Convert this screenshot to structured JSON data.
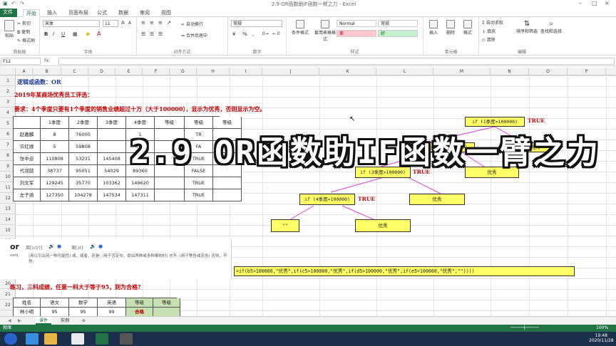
{
  "window": {
    "title": "2.9 OR函数助IF函数一臂之力 - Excel"
  },
  "tabs": [
    "文件",
    "开始",
    "插入",
    "页面布局",
    "公式",
    "数据",
    "审阅",
    "视图"
  ],
  "ribbon": {
    "clipboard": {
      "label": "剪贴板",
      "paste": "粘贴",
      "cut": "剪切",
      "copy": "复制",
      "format_painter": "格式刷"
    },
    "font": {
      "label": "字体",
      "name": "宋体",
      "size": "11",
      "bold": "B",
      "italic": "I",
      "underline": "U"
    },
    "alignment": {
      "label": "对齐方式",
      "wrap": "自动换行",
      "merge": "合并后居中"
    },
    "number": {
      "label": "数字",
      "format": "常规",
      "percent": "%",
      "comma": ","
    },
    "styles": {
      "label": "样式",
      "conditional": "条件格式",
      "table": "套用表格格式",
      "cells": [
        {
          "text": "Normal",
          "bg": "#ffffff"
        },
        {
          "text": "常规",
          "bg": "#ffffff"
        },
        {
          "text": "差",
          "bg": "#ffc7ce"
        },
        {
          "text": "好",
          "bg": "#c6efce"
        }
      ]
    },
    "cells": {
      "label": "单元格",
      "insert": "插入",
      "delete": "删除",
      "format": "格式"
    },
    "editing": {
      "label": "编辑",
      "autosum": "自动求和",
      "fill": "填充",
      "clear": "清除",
      "sort": "排序和筛选",
      "find": "查找和选择"
    }
  },
  "formula_bar": {
    "name_box": "F12",
    "fx": "fx",
    "content": ""
  },
  "columns": [
    "A",
    "B",
    "C",
    "D",
    "E",
    "F",
    "G",
    "H",
    "I",
    "J",
    "K",
    "L",
    "M",
    "N",
    "O",
    "P"
  ],
  "rows": [
    "1",
    "2",
    "3",
    "4",
    "5",
    "6",
    "7",
    "8",
    "9",
    "10",
    "11",
    "12",
    "13",
    "14",
    "15",
    "16",
    "17",
    "18",
    "19",
    "20",
    "21",
    "22"
  ],
  "sheet": {
    "heading": "逻辑或函数：OR",
    "line2": "2019年某商场优秀员工评选：",
    "line3": "要求：4个季度只要有1个季度的销售业绩超过十万（大于100000），显示为优秀，否则显示为空。",
    "table_headers": [
      "",
      "1季度",
      "2季度",
      "3季度",
      "4季度",
      "等级",
      "等级",
      "等级"
    ],
    "table_rows": [
      [
        "赵嘉麟",
        "8",
        "76000",
        "",
        "1",
        "",
        "TR",
        ""
      ],
      [
        "许红顺",
        "5",
        "59808",
        "",
        "749",
        "",
        "FA",
        ""
      ],
      [
        "张中迎",
        "110808",
        "53231",
        "145408",
        "89225",
        "",
        "TRUE",
        ""
      ],
      [
        "代润喆",
        "38737",
        "95051",
        "54029",
        "89360",
        "",
        "FALSE",
        ""
      ],
      [
        "刘文军",
        "129245",
        "35770",
        "103362",
        "149620",
        "",
        "TRUE",
        ""
      ],
      [
        "左子涵",
        "127350",
        "104278",
        "147534",
        "147311",
        "",
        "TRUE",
        ""
      ]
    ],
    "flow": {
      "n1": "if (1季度>100000)",
      "t1": "TRUE",
      "n2": "if (2季度>100000)",
      "y1": "优秀",
      "n3": "if (3季度>100000)",
      "t3": "TRUE",
      "y2": "优秀",
      "n4": "if (4季度>100000)",
      "t4": "TRUE",
      "y3": "优秀",
      "empty": "\"\"",
      "y4": "优秀"
    },
    "formula": "=if(b5>100000,\"优秀\",if(c5>100000,\"优秀\",if(d5>100000,\"优秀\",if(e5>100000,\"优秀\",\"\"))))",
    "exercise": "练习，三科成绩，任意一科大于等于95，则为合格？",
    "ex_headers": [
      "姓名",
      "语文",
      "数学",
      "英语",
      "等级",
      "等级"
    ],
    "ex_row": [
      "林小明",
      "95",
      "95",
      "99",
      "合格",
      ""
    ]
  },
  "dictionary": {
    "word": "or",
    "phon1": "英[ɔː(r)]",
    "phon2": "美[ɔr]",
    "pos": "conj.",
    "def": "(用以引出另一种可能性) 或，或者，还是; (用于否定句，提出两种或多种事物时) 也不; (用于警告或忠告) 否则，不然;"
  },
  "overlay_title": "2.9 OR函数助IF函数一臂之力",
  "sheet_tabs": [
    "课件",
    "实例"
  ],
  "status": {
    "left": "就绪",
    "zoom": "100%"
  },
  "taskbar": {
    "time": "19:48",
    "date": "2020/11/28"
  }
}
